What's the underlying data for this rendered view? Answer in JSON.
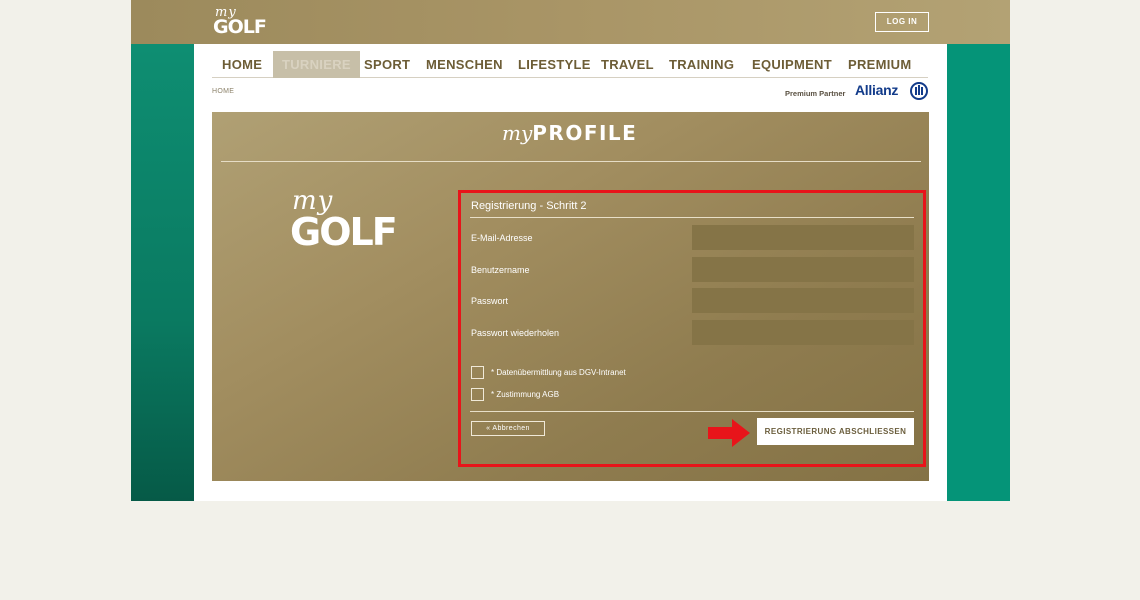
{
  "header": {
    "logo_my": "my",
    "logo_golf": "GOLF",
    "login_label": "LOG IN"
  },
  "nav": {
    "items": [
      {
        "label": "HOME"
      },
      {
        "label": "TURNIERE"
      },
      {
        "label": "SPORT"
      },
      {
        "label": "MENSCHEN"
      },
      {
        "label": "LIFESTYLE"
      },
      {
        "label": "TRAVEL"
      },
      {
        "label": "TRAINING"
      },
      {
        "label": "EQUIPMENT"
      },
      {
        "label": "PREMIUM"
      }
    ],
    "active": "TURNIERE"
  },
  "breadcrumb": "HOME",
  "partner": {
    "label": "Premium Partner",
    "brand": "Allianz"
  },
  "profile": {
    "title_my": "my",
    "title_word": "PROFILE",
    "logo_my": "my",
    "logo_golf": "GOLF"
  },
  "form": {
    "title": "Registrierung - Schritt 2",
    "fields": [
      {
        "label": "E-Mail-Adresse",
        "value": ""
      },
      {
        "label": "Benutzername",
        "value": ""
      },
      {
        "label": "Passwort",
        "value": ""
      },
      {
        "label": "Passwort wiederholen",
        "value": ""
      }
    ],
    "checkboxes": [
      {
        "label": "* Datenübermittlung aus DGV-Intranet",
        "checked": false
      },
      {
        "label": "* Zustimmung AGB",
        "checked": false
      }
    ],
    "cancel_label": "« Abbrechen",
    "submit_label": "REGISTRIERUNG ABSCHLIESSEN"
  },
  "colors": {
    "gold": "#a08d5f",
    "teal": "#059478",
    "highlight": "#e8141a"
  }
}
